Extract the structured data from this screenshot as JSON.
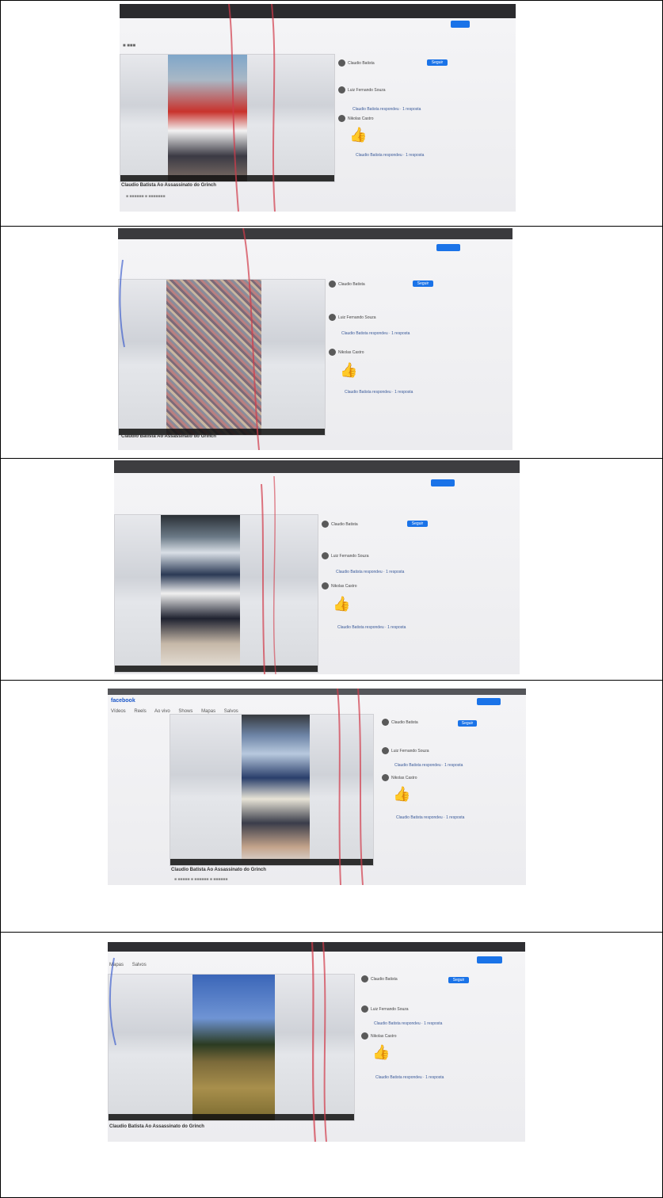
{
  "rows": [
    {
      "id": "photo-1",
      "video_title": "Claudio Batista Ao Assassinato do Grinch",
      "channel_name": "Claudio Batista",
      "follow_label": "Seguir",
      "commenter_1": "Luiz Fernando Souza",
      "commenter_2": "Nikolas Castro",
      "reply_text": "Claudio Batista respondeu · 1 resposta",
      "thumb_emoji": "👍"
    },
    {
      "id": "photo-2",
      "video_title": "Claudio Batista Ao Assassinato do Grinch",
      "channel_name": "Claudio Batista",
      "follow_label": "Seguir",
      "commenter_1": "Luiz Fernando Souza",
      "commenter_2": "Nikolas Castro",
      "reply_text": "Claudio Batista respondeu · 1 resposta",
      "thumb_emoji": "👍"
    },
    {
      "id": "photo-3",
      "video_title": "",
      "channel_name": "Claudio Batista",
      "follow_label": "Seguir",
      "commenter_1": "Luiz Fernando Souza",
      "commenter_2": "Nikolas Castro",
      "reply_text": "Claudio Batista respondeu · 1 resposta",
      "thumb_emoji": "👍"
    },
    {
      "id": "photo-4",
      "brand": "facebook",
      "tabs": [
        "Vídeos",
        "Reels",
        "Ao vivo",
        "Shows",
        "Mapas",
        "Salvos"
      ],
      "video_title": "Claudio Batista Ao Assassinato do Grinch",
      "channel_name": "Claudio Batista",
      "follow_label": "Seguir",
      "commenter_1": "Luiz Fernando Souza",
      "commenter_2": "Nikolas Castro",
      "reply_text": "Claudio Batista respondeu · 1 resposta",
      "thumb_emoji": "👍"
    },
    {
      "id": "photo-5",
      "tabs": [
        "Mapas",
        "Salvos"
      ],
      "video_title": "Claudio Batista Ao Assassinato do Grinch",
      "channel_name": "Claudio Batista",
      "follow_label": "Seguir",
      "commenter_1": "Luiz Fernando Souza",
      "commenter_2": "Nikolas Castro",
      "reply_text": "Claudio Batista respondeu · 1 resposta",
      "thumb_emoji": "👍"
    }
  ],
  "colors": {
    "table_border": "#000000",
    "accent_blue": "#1a73e8",
    "pen_red": "#d23a4a",
    "pen_blue": "#2a4fc9"
  }
}
